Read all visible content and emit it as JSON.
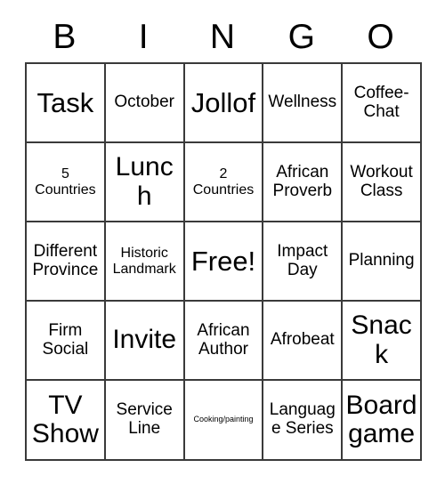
{
  "card": {
    "title": "BINGO",
    "header_letters": [
      "B",
      "I",
      "N",
      "G",
      "O"
    ],
    "rows": [
      [
        {
          "label": "Task",
          "size": "xl"
        },
        {
          "label": "October",
          "size": "md"
        },
        {
          "label": "Jollof",
          "size": "xl"
        },
        {
          "label": "Wellness",
          "size": "md"
        },
        {
          "label": "Coffee-Chat",
          "size": "md"
        }
      ],
      [
        {
          "label": "5 Countries",
          "size": "sm"
        },
        {
          "label": "Lunch",
          "size": "lg"
        },
        {
          "label": "2 Countries",
          "size": "sm"
        },
        {
          "label": "African Proverb",
          "size": "md"
        },
        {
          "label": "Workout Class",
          "size": "md"
        }
      ],
      [
        {
          "label": "Different Province",
          "size": "md"
        },
        {
          "label": "Historic Landmark",
          "size": "sm"
        },
        {
          "label": "Free!",
          "size": "xl"
        },
        {
          "label": "Impact Day",
          "size": "md"
        },
        {
          "label": "Planning",
          "size": "md"
        }
      ],
      [
        {
          "label": "Firm Social",
          "size": "md"
        },
        {
          "label": "Invite",
          "size": "lg"
        },
        {
          "label": "African Author",
          "size": "md"
        },
        {
          "label": "Afrobeat",
          "size": "md"
        },
        {
          "label": "Snack",
          "size": "lg"
        }
      ],
      [
        {
          "label": "TV Show",
          "size": "lg"
        },
        {
          "label": "Service Line",
          "size": "md"
        },
        {
          "label": "Cooking/painting",
          "size": "xs"
        },
        {
          "label": "Language Series",
          "size": "md"
        },
        {
          "label": "Board game",
          "size": "lg"
        }
      ]
    ],
    "free_space": "Free!",
    "colors": {
      "background": "#ffffff",
      "border": "#3a3a3a",
      "text": "#000000"
    }
  }
}
